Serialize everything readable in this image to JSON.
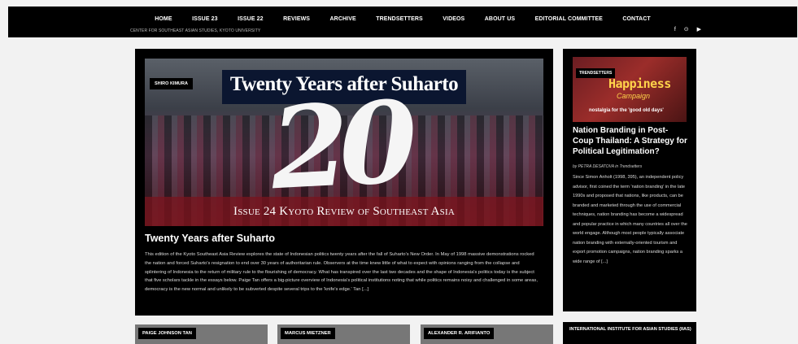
{
  "nav": {
    "items": [
      "HOME",
      "ISSUE 23",
      "ISSUE 22",
      "REVIEWS",
      "ARCHIVE",
      "TRENDSETTERS",
      "VIDEOS",
      "ABOUT US",
      "EDITORIAL COMMITTEE",
      "CONTACT"
    ],
    "tagline": "CENTER FOR SOUTHEAST ASIAN STUDIES, KYOTO UNIVERSITY",
    "social": {
      "facebook": "f",
      "pinterest": "⊙",
      "youtube": "▶"
    }
  },
  "feature": {
    "author_tag": "SHIRO KIMURA",
    "image_title": "Twenty Years after Suharto",
    "image_number": "20",
    "image_issue": "Issue 24 Kyoto Review of Southeast Asia",
    "title": "Twenty Years after Suharto",
    "description": "This edition of the Kyoto Southeast Asia Review explores the state of Indonesian politics twenty years after the fall of Suharto's New Order. In May of 1998 massive demonstrations rocked the nation and forced Suharto's resignation to end over 30 years of authoritarian rule. Observers at the time knew little of what to expect with opinions ranging from the collapse and splintering of Indonesia to the return of military rule to the flourishing of democracy. What has transpired over the last two decades and the shape of Indonesia's politics today is the subject that five scholars tackle in the essays below. Paige Tan offers a big-picture overview of Indonesia's political institutions noting that while politics remains noisy and challenged in some areas, democracy is the new normal and unlikely to be subverted despite several trips to the 'knife's edge.' Tan [...]"
  },
  "sidebar": {
    "tag": "TRENDSETTERS",
    "thumb_line1": "Happiness",
    "thumb_line2": "Campaign",
    "thumb_line3": "nostalgia for the 'good old days'",
    "title": "Nation Branding in Post-Coup Thailand: A Strategy for Political Legitimation?",
    "byline": "by PETRA DESATOVA in Trendsetters",
    "description": "Since Simon Anholt (1998, 395), an independent policy advisor, first coined the term 'nation branding' in the late 1990s and proposed that nations, like products, can be branded and marketed through the use of commercial techniques, nation branding has become a widespread and popular practice in which many countries all over the world engage. Although most people typically associate nation branding with externally-oriented tourism and export promotion campaigns, nation branding sparks a wide range of [...]"
  },
  "authors": [
    "PAIGE JOHNSON TAN",
    "MARCUS MIETZNER",
    "ALEXANDER R. ARIFIANTO"
  ],
  "iias": {
    "title": "INTERNATIONAL INSTITUTE FOR ASIAN STUDIES (IIAS)"
  }
}
